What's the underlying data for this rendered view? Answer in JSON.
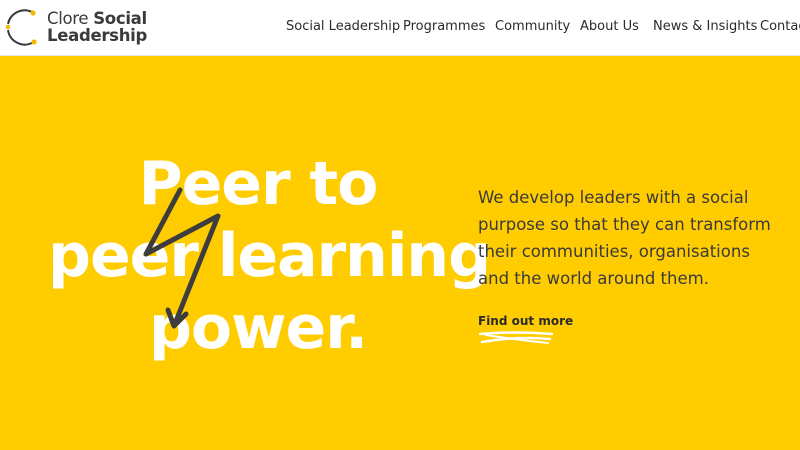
{
  "brand": {
    "name_light": "Clore ",
    "name_bold_1": "Social",
    "name_bold_2": "Leadership",
    "logo_icon": "circular-arrows-icon"
  },
  "nav": {
    "items": [
      "Social Leadership",
      "Programmes",
      "Community",
      "About Us",
      "News & Insights",
      "Contact"
    ]
  },
  "hero": {
    "headline_lines": [
      "Peer to",
      "peer learning",
      "power."
    ],
    "decoration_icon": "lightning-bolt-icon",
    "intro": "We develop leaders with a social purpose so that they can transform their communities, organisations and the world around them.",
    "cta_label": "Find out more"
  },
  "colors": {
    "hero_bg": "#FFCC00",
    "text_dark": "#3a3a3a",
    "headline": "#ffffff",
    "logo_accent": "#F5B800"
  }
}
